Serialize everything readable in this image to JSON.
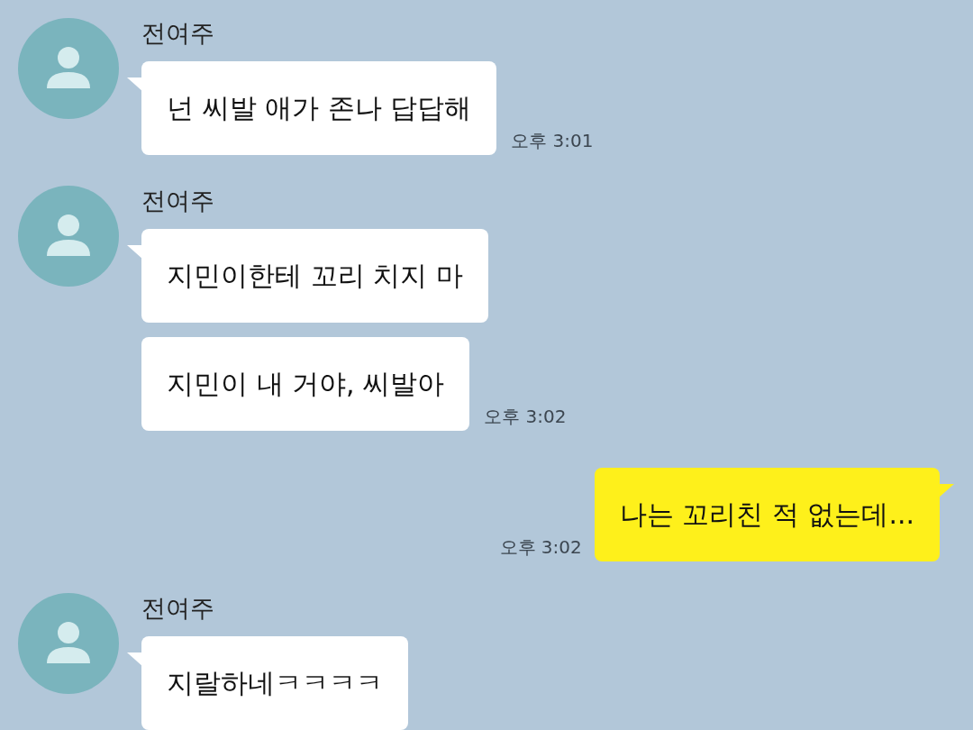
{
  "messages": [
    {
      "kind": "received",
      "sender": "전여주",
      "bubbles": [
        "넌 씨발 애가 존나 답답해"
      ],
      "time": "오후 3:01"
    },
    {
      "kind": "received",
      "sender": "전여주",
      "bubbles": [
        "지민이한테 꼬리 치지 마",
        "지민이 내 거야, 씨발아"
      ],
      "time": "오후 3:02"
    },
    {
      "kind": "sent",
      "bubbles": [
        "나는 꼬리친 적 없는데..."
      ],
      "time": "오후 3:02"
    },
    {
      "kind": "received",
      "sender": "전여주",
      "bubbles": [
        "지랄하네ㅋㅋㅋㅋ"
      ]
    }
  ]
}
